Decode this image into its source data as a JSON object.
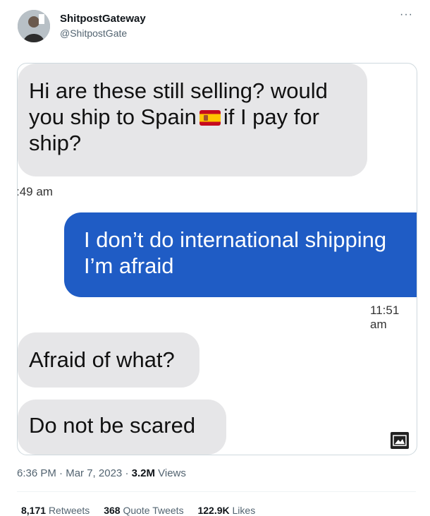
{
  "author": {
    "name": "ShitpostGateway",
    "handle": "@ShitpostGate"
  },
  "more_icon": "more-options-icon",
  "media": {
    "messages": [
      {
        "side": "in",
        "line1": "Hi are these still selling? would",
        "line2a": "you ship to Spain",
        "line2b": "if I pay for",
        "line3": "ship?"
      },
      {
        "side": "out",
        "line1": "I don’t do international shipping",
        "line2": "I’m afraid"
      },
      {
        "side": "in",
        "text": "Afraid of what?"
      },
      {
        "side": "in",
        "text": "Do not be scared"
      }
    ],
    "timestamps": [
      ":49 am",
      "11:51 am"
    ],
    "image_icon": "image-icon"
  },
  "meta": {
    "time": "6:36 PM",
    "date": "Mar 7, 2023",
    "views_count": "3.2M",
    "views_label": "Views"
  },
  "stats": {
    "retweets_count": "8,171",
    "retweets_label": "Retweets",
    "quotes_count": "368",
    "quotes_label": "Quote Tweets",
    "likes_count": "122.9K",
    "likes_label": "Likes"
  },
  "colors": {
    "outgoing_bubble": "#1f5cc5",
    "incoming_bubble": "#e6e6e8",
    "secondary_text": "#536471"
  }
}
